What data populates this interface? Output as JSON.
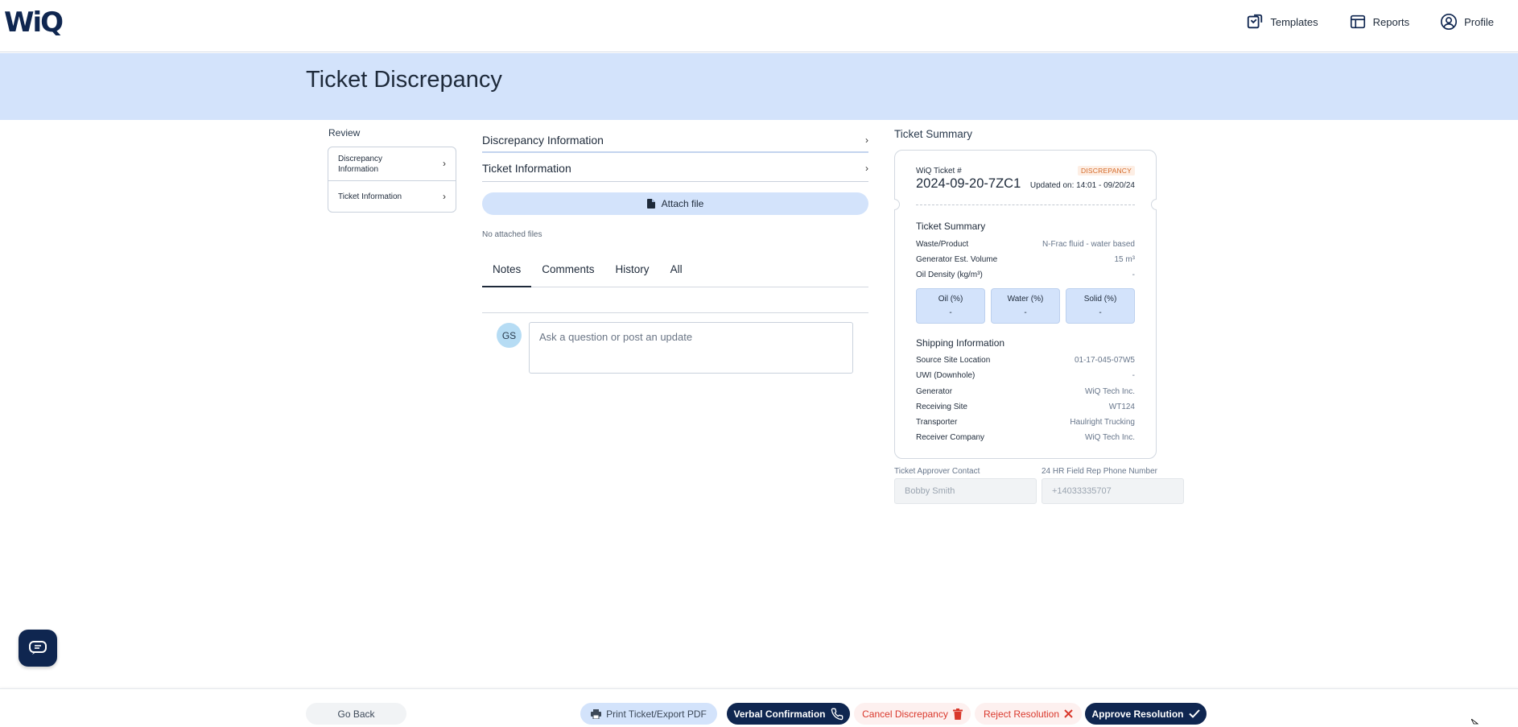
{
  "app": {
    "logo": "WiQ"
  },
  "topnav": {
    "templates": "Templates",
    "reports": "Reports",
    "profile": "Profile"
  },
  "page": {
    "title": "Ticket Discrepancy"
  },
  "review": {
    "label": "Review",
    "items": [
      {
        "label": "Discrepancy Information"
      },
      {
        "label": "Ticket Information"
      }
    ]
  },
  "middle": {
    "sections": [
      {
        "label": "Discrepancy Information"
      },
      {
        "label": "Ticket Information"
      }
    ],
    "attach_label": "Attach file",
    "no_files": "No attached files",
    "tabs": [
      {
        "label": "Notes",
        "active": true
      },
      {
        "label": "Comments"
      },
      {
        "label": "History"
      },
      {
        "label": "All"
      }
    ],
    "avatar_initials": "GS",
    "note_placeholder": "Ask a question or post an update"
  },
  "summary": {
    "label": "Ticket Summary",
    "ticket_label": "WiQ Ticket #",
    "badge": "DISCREPANCY",
    "ticket_number": "2024-09-20-7ZC1",
    "updated": "Updated on: 14:01 - 09/20/24",
    "ticket_section": {
      "title": "Ticket Summary",
      "rows": [
        {
          "key": "Waste/Product",
          "value": "N-Frac fluid - water based"
        },
        {
          "key": "Generator Est. Volume",
          "value": "15 m³"
        },
        {
          "key": "Oil Density (kg/m³)",
          "value": "-"
        }
      ]
    },
    "percentages": [
      {
        "label": "Oil (%)",
        "value": "-"
      },
      {
        "label": "Water (%)",
        "value": "-"
      },
      {
        "label": "Solid (%)",
        "value": "-"
      }
    ],
    "shipping_section": {
      "title": "Shipping Information",
      "rows": [
        {
          "key": "Source Site Location",
          "value": "01-17-045-07W5"
        },
        {
          "key": "UWI (Downhole)",
          "value": "-"
        },
        {
          "key": "Generator",
          "value": "WiQ Tech Inc."
        },
        {
          "key": "Receiving Site",
          "value": "WT124"
        },
        {
          "key": "Transporter",
          "value": "Haulright Trucking"
        },
        {
          "key": "Receiver Company",
          "value": "WiQ Tech Inc."
        }
      ]
    }
  },
  "contacts": {
    "approver_label": "Ticket Approver Contact",
    "approver_value": "Bobby Smith",
    "fieldrep_label": "24 HR Field Rep Phone Number",
    "fieldrep_value": "+14033335707"
  },
  "footer": {
    "go_back": "Go Back",
    "print": "Print Ticket/Export PDF",
    "verbal": "Verbal Confirmation",
    "cancel": "Cancel Discrepancy",
    "reject": "Reject Resolution",
    "approve": "Approve Resolution"
  },
  "colors": {
    "brand_navy": "#0f2650",
    "banner_blue": "#d3e3fb",
    "danger_red": "#d9372b",
    "badge_orange": "#d46a28"
  }
}
